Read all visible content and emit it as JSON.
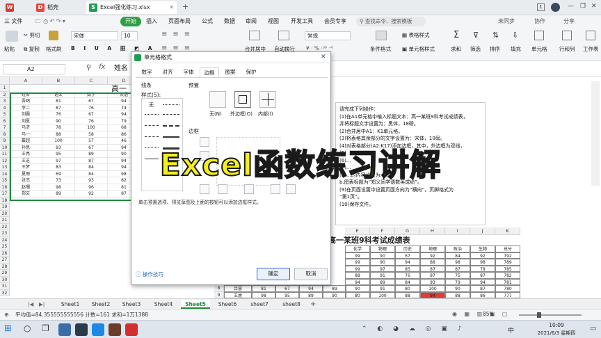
{
  "titlebar": {
    "tabs": [
      {
        "icon": "wps-home-icon",
        "label": ""
      },
      {
        "icon": "docer-icon",
        "label": "稻壳"
      },
      {
        "icon": "spreadsheet-icon",
        "label": "Excel强化练习.xlsx"
      }
    ],
    "new_tab": "+",
    "badge": "1"
  },
  "menu": {
    "file": "三 文件",
    "items": [
      "开始",
      "插入",
      "页面布局",
      "公式",
      "数据",
      "审阅",
      "视图",
      "开发工具",
      "会员专享"
    ],
    "active": "开始",
    "search": "查找命令、搜索模板",
    "right": [
      "未同步",
      "协作",
      "分享"
    ]
  },
  "toolbar": {
    "paste": "粘贴",
    "cut": "剪切",
    "copy": "复制",
    "format_painter": "格式刷",
    "font": "宋体",
    "size": "10",
    "number_format": "常规",
    "merge": "合并居中",
    "wrap": "自动换行",
    "cond_format": "条件格式",
    "table_style": "表格样式",
    "cell_style": "单元格样式",
    "sum": "求和",
    "filter": "筛选",
    "sort": "排序",
    "fill": "填充",
    "cell": "单元格",
    "rowcol": "行和列",
    "worksheet": "工作表"
  },
  "formula_bar": {
    "name_box": "A2",
    "fx": "fx",
    "content": "姓名"
  },
  "columns": [
    "A",
    "B",
    "C",
    "D",
    "E"
  ],
  "sheet_title": "高一",
  "table": {
    "headers": [
      "姓名",
      "语文",
      "数学",
      "英语"
    ],
    "rows": [
      [
        "吾鸥",
        "81",
        "67",
        "94"
      ],
      [
        "李二",
        "87",
        "76",
        "74"
      ],
      [
        "刘霸",
        "76",
        "67",
        "94"
      ],
      [
        "刘夏",
        "90",
        "76",
        "79"
      ],
      [
        "马济",
        "78",
        "100",
        "68"
      ],
      [
        "马一",
        "88",
        "58",
        "86"
      ],
      [
        "戴超",
        "100",
        "57",
        "46"
      ],
      [
        "孙思",
        "93",
        "67",
        "94"
      ],
      [
        "王亮",
        "95",
        "89",
        "90"
      ],
      [
        "王芝",
        "97",
        "87",
        "94"
      ],
      [
        "王梦",
        "83",
        "84",
        "94"
      ],
      [
        "夏雨",
        "69",
        "84",
        "98"
      ],
      [
        "张杰",
        "73",
        "93",
        "82"
      ],
      [
        "赵珊",
        "98",
        "96",
        "81"
      ],
      [
        "郑文",
        "89",
        "92",
        "87"
      ]
    ]
  },
  "row_numbers": [
    "1",
    "2",
    "3",
    "4",
    "5",
    "6",
    "7",
    "8",
    "9",
    "10",
    "11",
    "12",
    "13",
    "14",
    "15",
    "16",
    "17",
    "18",
    "19",
    "20",
    "21",
    "22",
    "23",
    "24",
    "25",
    "26",
    "27",
    "28",
    "29",
    "30",
    "31",
    "32"
  ],
  "dialog": {
    "title": "单元格格式",
    "tabs": [
      "数字",
      "对齐",
      "字体",
      "边框",
      "图案",
      "保护"
    ],
    "active_tab": "边框",
    "line_group": "线条",
    "style_label": "样式(S):",
    "none_label": "无",
    "preset_label": "预置",
    "presets": [
      "无(N)",
      "外边框(O)",
      "内部(I)"
    ],
    "border_label": "边框",
    "hint": "单击预置选项、预览草图及上面的按钮可以添加边框样式。",
    "tips": "操作技巧",
    "ok": "确定",
    "cancel": "取消"
  },
  "instructions": {
    "heading": "请完成下列操作：",
    "lines": [
      "(1)在A1单元格中输入标题文本：高一某班9科考试成绩表，",
      "并将标题文字设置为：黑体，18磅。",
      "(2)合并居中A1：K1单元格。",
      "(3)将表格其余部分的文字设置为：宋体，10磅。",
      "(4)对表格部分(A2:K17)添加边框，其中，外边框为双线，",
      "(5)...",
      "(6)...",
      "(7)...",
      "(8)...的内容设置为...",
      "b.图表标题为“郑义同学语数英成绩”。",
      "(9)在页面设置中设置页面方向为“横向”，页脚格式为",
      "“第1页”。",
      "(10)保存文件。"
    ]
  },
  "overlay_title": "Excel函数练习讲解",
  "preview": {
    "title": "高一某班9科考试成绩表",
    "cols": [
      "E",
      "F",
      "G",
      "H",
      "I",
      "J",
      "K"
    ],
    "headers": [
      "化学",
      "物理",
      "历史",
      "地理",
      "政治",
      "生物",
      "总分"
    ],
    "rows": [
      [
        "99",
        "90",
        "67",
        "92",
        "84",
        "92",
        "792"
      ],
      [
        "99",
        "90",
        "94",
        "88",
        "98",
        "98",
        "789"
      ],
      [
        "99",
        "97",
        "85",
        "87",
        "87",
        "78",
        "785"
      ],
      [
        "88",
        "91",
        "76",
        "87",
        "75",
        "87",
        "782"
      ],
      [
        "94",
        "89",
        "84",
        "93",
        "79",
        "94",
        "781"
      ],
      [
        "90",
        "91",
        "80",
        "100",
        "90",
        "87",
        "780"
      ],
      [
        "80",
        "100",
        "88",
        "94",
        "88",
        "86",
        "777"
      ]
    ],
    "row_nums": [
      "8",
      "9"
    ],
    "left_names": [
      "吕慧",
      "王虎"
    ],
    "left_vals": [
      [
        "81",
        "67",
        "94",
        "89"
      ],
      [
        "98",
        "95",
        "89",
        "90"
      ]
    ],
    "highlight_color": "#e53935"
  },
  "sheet_tabs": [
    "Sheet1",
    "Sheet2",
    "Sheet3",
    "Sheet4",
    "Sheet5",
    "Sheet6",
    "sheet7",
    "sheet8"
  ],
  "active_sheet": "Sheet5",
  "status": {
    "stats": "平均值=84.355555555556  计数=161  求和=1万1388",
    "zoom": "85%"
  },
  "taskbar": {
    "time": "10:09",
    "date": "2021/6/3 星期四",
    "ime": "中"
  },
  "colors": {
    "accent_green": "#2ea043",
    "selection_green": "#1e8a3c",
    "title_yellow": "#f5ef1e"
  }
}
